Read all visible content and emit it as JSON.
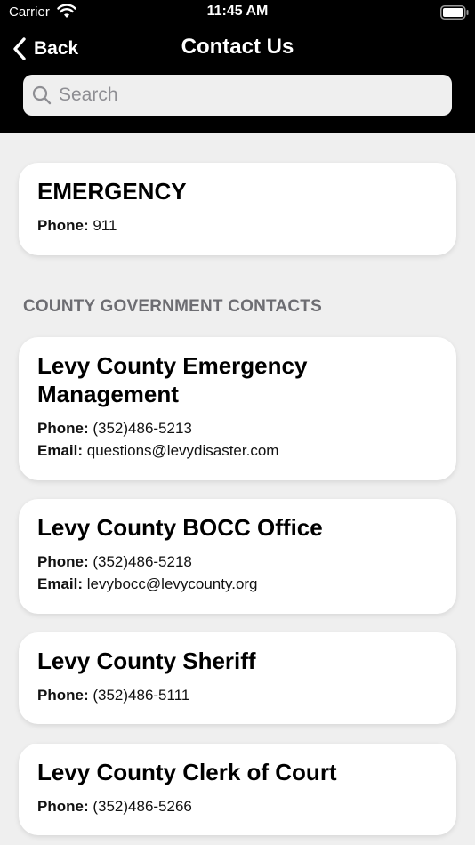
{
  "status_bar": {
    "carrier": "Carrier",
    "time": "11:45 AM"
  },
  "nav": {
    "back_label": "Back",
    "title": "Contact Us"
  },
  "search": {
    "placeholder": "Search"
  },
  "emergency": {
    "title": "EMERGENCY",
    "phone_label": "Phone:",
    "phone": "911"
  },
  "section_header": "COUNTY GOVERNMENT CONTACTS",
  "contacts": [
    {
      "title_line1": "Levy County Emergency",
      "title_line2": "Management",
      "phone_label": "Phone:",
      "phone": "(352)486-5213",
      "email_label": "Email:",
      "email": "questions@levydisaster.com"
    },
    {
      "title": "Levy County BOCC Office",
      "phone_label": "Phone:",
      "phone": "(352)486-5218",
      "email_label": "Email:",
      "email": "levybocc@levycounty.org"
    },
    {
      "title": "Levy County Sheriff",
      "phone_label": "Phone:",
      "phone": "(352)486-5111"
    },
    {
      "title": "Levy County Clerk of Court",
      "phone_label": "Phone:",
      "phone": "(352)486-5266"
    }
  ],
  "colors": {
    "header_bg": "#000000",
    "page_bg": "#efefef",
    "card_bg": "#ffffff",
    "section_header": "#6d6d72"
  }
}
